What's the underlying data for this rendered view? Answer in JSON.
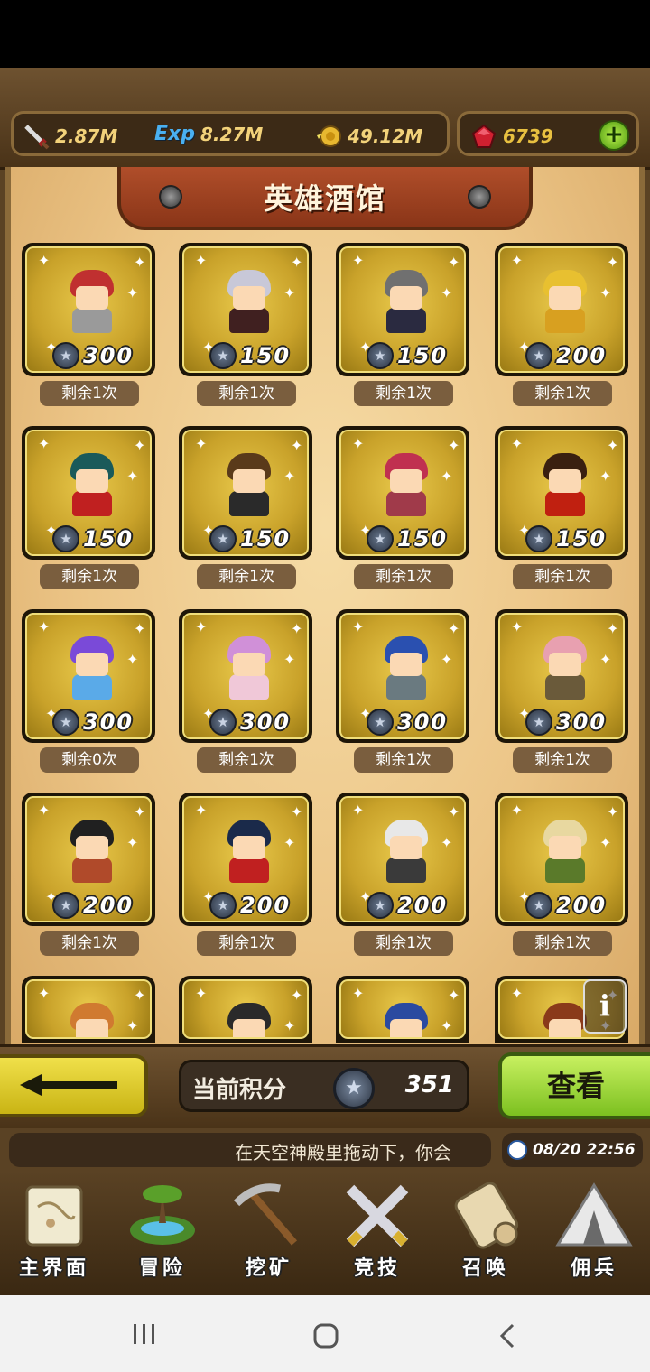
{
  "resources": {
    "attack": {
      "icon": "sword-icon",
      "value": "2.87M"
    },
    "exp": {
      "icon": "exp-icon",
      "label": "Exp",
      "value": "8.27M"
    },
    "gold": {
      "icon": "gold-coin-icon",
      "value": "49.12M"
    },
    "gems": {
      "icon": "ruby-icon",
      "value": "6739"
    }
  },
  "title": "英雄酒馆",
  "heroes": [
    {
      "cost": "300",
      "remaining": "剩余1次",
      "hair": "#c03030",
      "body": "#9a9a9a"
    },
    {
      "cost": "150",
      "remaining": "剩余1次",
      "hair": "#c8c8d8",
      "body": "#402020"
    },
    {
      "cost": "150",
      "remaining": "剩余1次",
      "hair": "#707070",
      "body": "#2a2a40"
    },
    {
      "cost": "200",
      "remaining": "剩余1次",
      "hair": "#e8c030",
      "body": "#d8a020"
    },
    {
      "cost": "150",
      "remaining": "剩余1次",
      "hair": "#1a5a5a",
      "body": "#c02020"
    },
    {
      "cost": "150",
      "remaining": "剩余1次",
      "hair": "#5a3a1a",
      "body": "#2a2a2a"
    },
    {
      "cost": "150",
      "remaining": "剩余1次",
      "hair": "#c03050",
      "body": "#a03a4a"
    },
    {
      "cost": "150",
      "remaining": "剩余1次",
      "hair": "#3a2010",
      "body": "#c02010"
    },
    {
      "cost": "300",
      "remaining": "剩余0次",
      "hair": "#7a4ad8",
      "body": "#5aaae8"
    },
    {
      "cost": "300",
      "remaining": "剩余1次",
      "hair": "#d090d8",
      "body": "#f0c8d8"
    },
    {
      "cost": "300",
      "remaining": "剩余1次",
      "hair": "#2a50b0",
      "body": "#6a7a80"
    },
    {
      "cost": "300",
      "remaining": "剩余1次",
      "hair": "#e8a0b0",
      "body": "#6a5a3a"
    },
    {
      "cost": "200",
      "remaining": "剩余1次",
      "hair": "#202020",
      "body": "#b04a2a"
    },
    {
      "cost": "200",
      "remaining": "剩余1次",
      "hair": "#1a2a4a",
      "body": "#c02020"
    },
    {
      "cost": "200",
      "remaining": "剩余1次",
      "hair": "#e8e8e8",
      "body": "#3a3a3a"
    },
    {
      "cost": "200",
      "remaining": "剩余1次",
      "hair": "#e8d8a0",
      "body": "#5a7a2a"
    },
    {
      "hair": "#d07a30",
      "body": "#c02020"
    },
    {
      "hair": "#2a2a2a",
      "body": "#5a5a5a"
    },
    {
      "hair": "#2a4aa0",
      "body": "#3a3a6a"
    },
    {
      "hair": "#8a3a1a",
      "body": "#c04a2a"
    }
  ],
  "score": {
    "label": "当前积分",
    "value": "351"
  },
  "view_button": "查看",
  "ticker": "在天空神殿里拖动下，你会",
  "clock": "08/20 22:56",
  "nav": [
    {
      "label": "主界面",
      "icon": "scroll-map-icon"
    },
    {
      "label": "冒险",
      "icon": "island-icon"
    },
    {
      "label": "挖矿",
      "icon": "pickaxe-icon"
    },
    {
      "label": "竞技",
      "icon": "crossed-swords-icon"
    },
    {
      "label": "召唤",
      "icon": "summon-scroll-icon"
    },
    {
      "label": "佣兵",
      "icon": "tent-icon"
    }
  ],
  "colors": {
    "accent_green": "#7cc020",
    "back_yellow": "#e8d42a",
    "panel_brown": "#3a2a1a"
  }
}
